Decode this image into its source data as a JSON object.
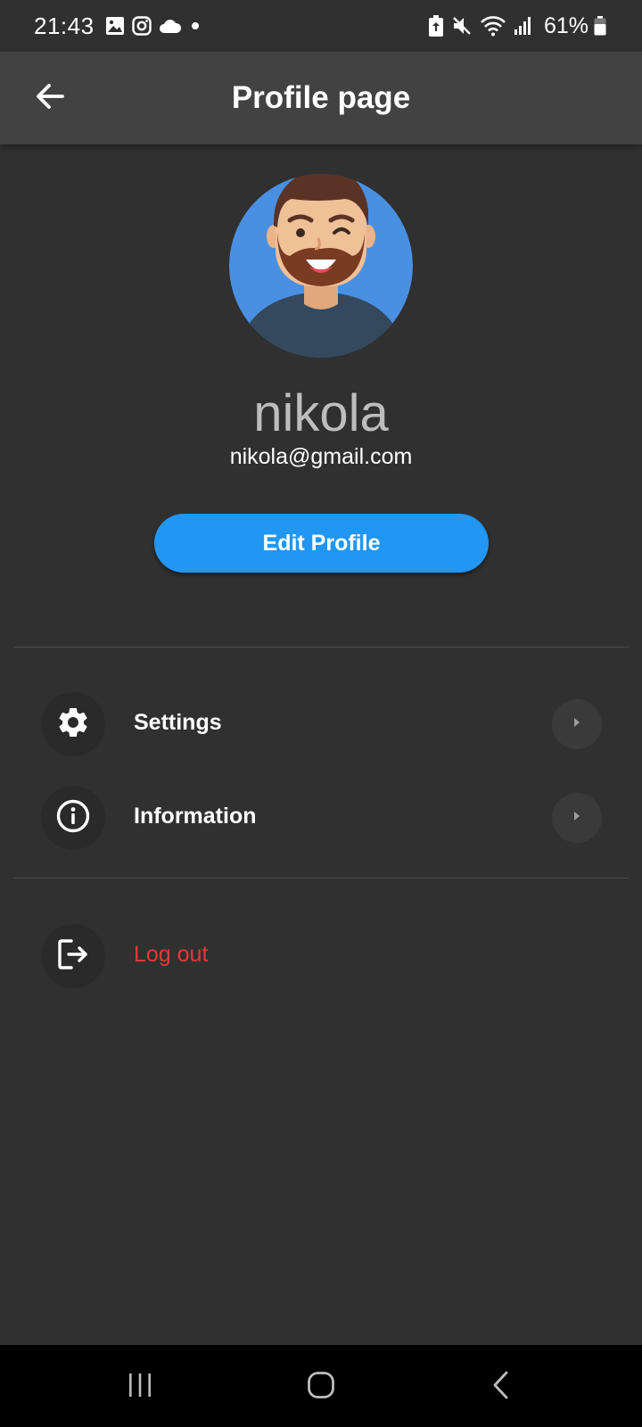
{
  "status_bar": {
    "time": "21:43",
    "left_icons": [
      "gallery-icon",
      "instagram-icon",
      "cloud-icon",
      "dot-icon"
    ],
    "right_icons": [
      "battery-saver-icon",
      "mute-icon",
      "wifi-icon",
      "signal-icon"
    ],
    "battery_percent": "61%"
  },
  "app_bar": {
    "title": "Profile page",
    "back_icon": "arrow-back-icon"
  },
  "profile": {
    "name": "nikola",
    "email": "nikola@gmail.com",
    "edit_button_label": "Edit Profile"
  },
  "menu": {
    "items": [
      {
        "label": "Settings",
        "icon": "gear-icon"
      },
      {
        "label": "Information",
        "icon": "info-icon"
      }
    ],
    "logout": {
      "label": "Log out",
      "icon": "logout-icon"
    }
  },
  "nav_bar": {
    "buttons": [
      "recents-icon",
      "home-icon",
      "back-icon"
    ]
  },
  "colors": {
    "background": "#303030",
    "app_bar": "#424242",
    "accent": "#2196f3",
    "logout": "#e53935",
    "name_text": "#bdbdbd"
  }
}
